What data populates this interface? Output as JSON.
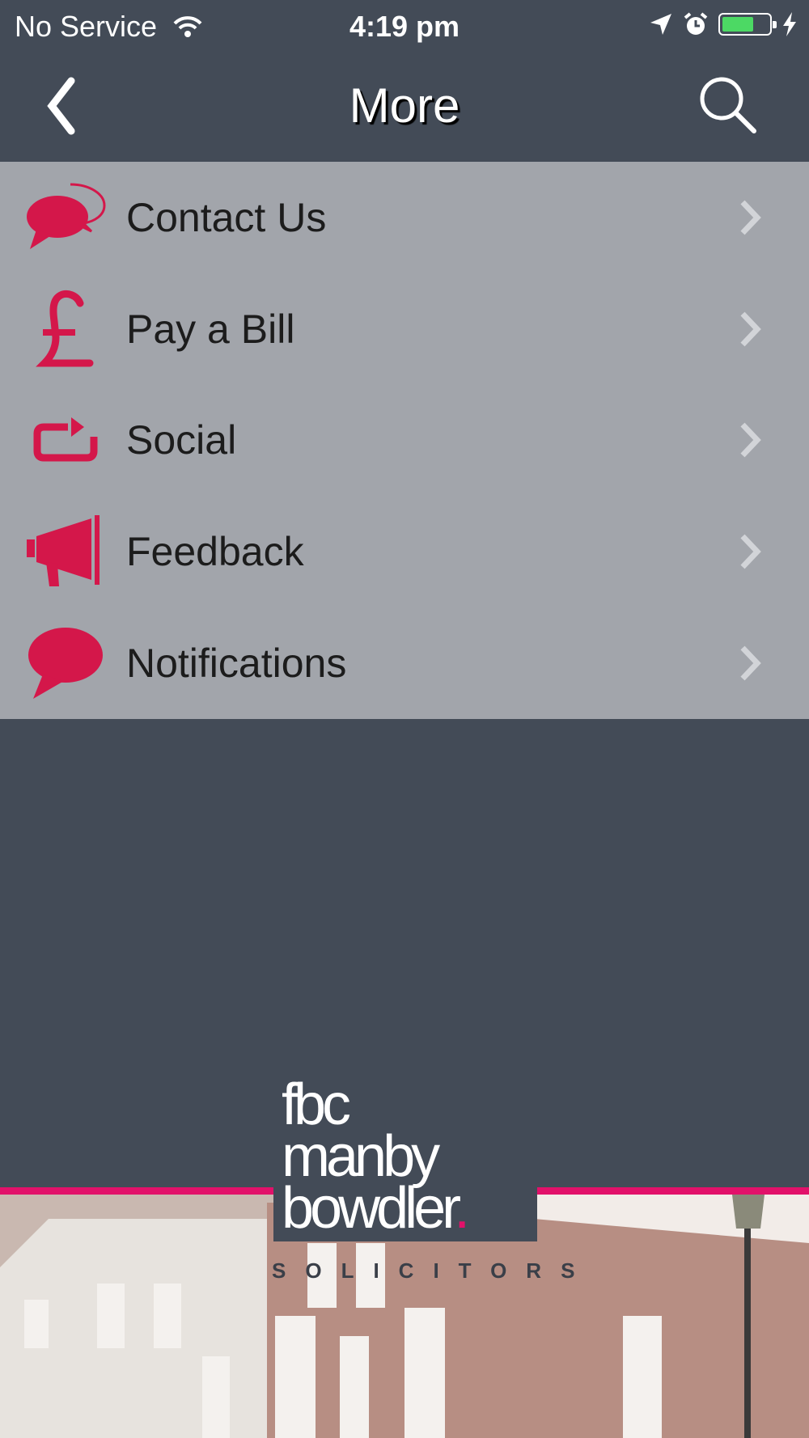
{
  "status_bar": {
    "carrier": "No Service",
    "time": "4:19 pm",
    "battery_level": 0.62,
    "icons": [
      "wifi-icon",
      "location-icon",
      "alarm-icon",
      "battery-icon",
      "charging-icon"
    ]
  },
  "nav": {
    "title": "More",
    "back_icon": "chevron-left-icon",
    "search_icon": "search-icon"
  },
  "menu": {
    "items": [
      {
        "label": "Contact Us",
        "icon": "speech-bubbles-icon"
      },
      {
        "label": "Pay a Bill",
        "icon": "pound-sign-icon"
      },
      {
        "label": "Social",
        "icon": "share-icon"
      },
      {
        "label": "Feedback",
        "icon": "megaphone-icon"
      },
      {
        "label": "Notifications",
        "icon": "speech-bubble-icon"
      }
    ]
  },
  "brand": {
    "line1": "fbc",
    "line2": "manby",
    "line3": "bowdler",
    "dot": ".",
    "tagline": "SOLICITORS"
  },
  "colors": {
    "background": "#434b57",
    "menu_background": "#a2a5ab",
    "accent": "#e2116a",
    "icon": "#d4174a"
  }
}
